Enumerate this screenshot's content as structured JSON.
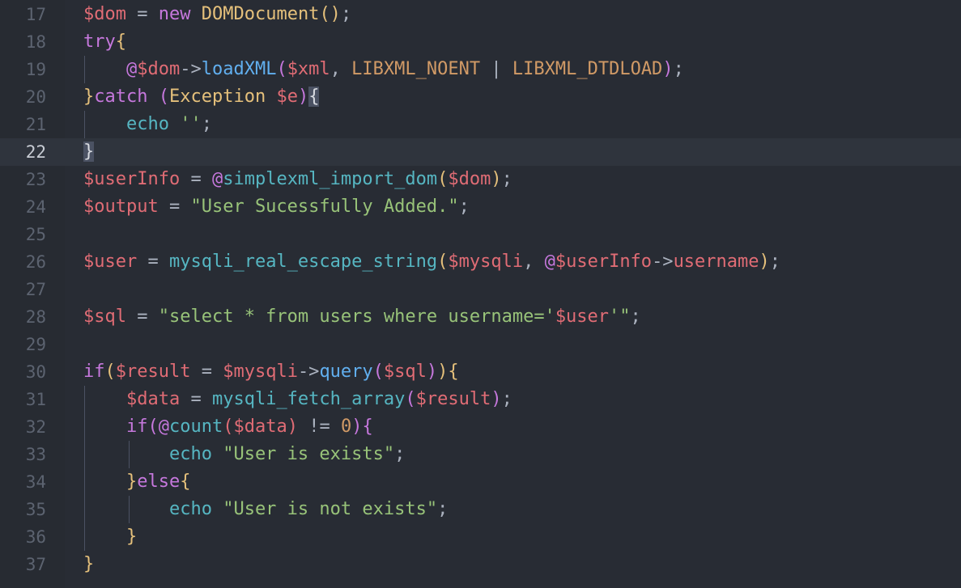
{
  "editor": {
    "theme_colors": {
      "background": "#282c34",
      "variable": "#e06c75",
      "keyword": "#c678dd",
      "class": "#e5c07b",
      "function": "#61afef",
      "builtin": "#56b6c2",
      "string": "#98c379",
      "constant": "#d19a66"
    },
    "current_line": 22,
    "lines": [
      {
        "number": "17",
        "tokens": [
          {
            "text": "$dom",
            "type": "v"
          },
          {
            "text": " = ",
            "type": "p"
          },
          {
            "text": "new",
            "type": "k"
          },
          {
            "text": " ",
            "type": "p"
          },
          {
            "text": "DOMDocument",
            "type": "c"
          },
          {
            "text": "()",
            "type": "pg"
          },
          {
            "text": ";",
            "type": "p"
          }
        ]
      },
      {
        "number": "18",
        "tokens": [
          {
            "text": "try",
            "type": "k"
          },
          {
            "text": "{",
            "type": "pg"
          }
        ]
      },
      {
        "number": "19",
        "tokens": [
          {
            "text": "    ",
            "type": "p"
          },
          {
            "text": "@",
            "type": "k"
          },
          {
            "text": "$dom",
            "type": "v"
          },
          {
            "text": "->",
            "type": "p"
          },
          {
            "text": "loadXML",
            "type": "f"
          },
          {
            "text": "(",
            "type": "pp"
          },
          {
            "text": "$xml",
            "type": "v"
          },
          {
            "text": ", ",
            "type": "p"
          },
          {
            "text": "LIBXML_NOENT",
            "type": "n"
          },
          {
            "text": " | ",
            "type": "p"
          },
          {
            "text": "LIBXML_DTDLOAD",
            "type": "n"
          },
          {
            "text": ")",
            "type": "pp"
          },
          {
            "text": ";",
            "type": "p"
          }
        ]
      },
      {
        "number": "20",
        "tokens": [
          {
            "text": "}",
            "type": "pg"
          },
          {
            "text": "catch",
            "type": "k"
          },
          {
            "text": " ",
            "type": "p"
          },
          {
            "text": "(",
            "type": "pp"
          },
          {
            "text": "Exception",
            "type": "c"
          },
          {
            "text": " ",
            "type": "p"
          },
          {
            "text": "$e",
            "type": "v"
          },
          {
            "text": ")",
            "type": "pp"
          },
          {
            "text": "{",
            "type": "hl"
          }
        ]
      },
      {
        "number": "21",
        "tokens": [
          {
            "text": "    ",
            "type": "p"
          },
          {
            "text": "echo",
            "type": "fi"
          },
          {
            "text": " ",
            "type": "p"
          },
          {
            "text": "''",
            "type": "s"
          },
          {
            "text": ";",
            "type": "p"
          }
        ]
      },
      {
        "number": "22",
        "tokens": [
          {
            "text": "}",
            "type": "hl"
          }
        ]
      },
      {
        "number": "23",
        "tokens": [
          {
            "text": "$userInfo",
            "type": "v"
          },
          {
            "text": " = ",
            "type": "p"
          },
          {
            "text": "@",
            "type": "k"
          },
          {
            "text": "simplexml_import_dom",
            "type": "fi"
          },
          {
            "text": "(",
            "type": "pg"
          },
          {
            "text": "$dom",
            "type": "v"
          },
          {
            "text": ")",
            "type": "pg"
          },
          {
            "text": ";",
            "type": "p"
          }
        ]
      },
      {
        "number": "24",
        "tokens": [
          {
            "text": "$output",
            "type": "v"
          },
          {
            "text": " = ",
            "type": "p"
          },
          {
            "text": "\"User Sucessfully Added.\"",
            "type": "s"
          },
          {
            "text": ";",
            "type": "p"
          }
        ]
      },
      {
        "number": "25",
        "tokens": []
      },
      {
        "number": "26",
        "tokens": [
          {
            "text": "$user",
            "type": "v"
          },
          {
            "text": " = ",
            "type": "p"
          },
          {
            "text": "mysqli_real_escape_string",
            "type": "fi"
          },
          {
            "text": "(",
            "type": "pg"
          },
          {
            "text": "$mysqli",
            "type": "v"
          },
          {
            "text": ", ",
            "type": "p"
          },
          {
            "text": "@",
            "type": "k"
          },
          {
            "text": "$userInfo",
            "type": "v"
          },
          {
            "text": "->",
            "type": "p"
          },
          {
            "text": "username",
            "type": "v"
          },
          {
            "text": ")",
            "type": "pg"
          },
          {
            "text": ";",
            "type": "p"
          }
        ]
      },
      {
        "number": "27",
        "tokens": []
      },
      {
        "number": "28",
        "tokens": [
          {
            "text": "$sql",
            "type": "v"
          },
          {
            "text": " = ",
            "type": "p"
          },
          {
            "text": "\"select * from users where username='",
            "type": "s"
          },
          {
            "text": "$user",
            "type": "v"
          },
          {
            "text": "'\"",
            "type": "s"
          },
          {
            "text": ";",
            "type": "p"
          }
        ]
      },
      {
        "number": "29",
        "tokens": []
      },
      {
        "number": "30",
        "tokens": [
          {
            "text": "if",
            "type": "k"
          },
          {
            "text": "(",
            "type": "pg"
          },
          {
            "text": "$result",
            "type": "v"
          },
          {
            "text": " = ",
            "type": "p"
          },
          {
            "text": "$mysqli",
            "type": "v"
          },
          {
            "text": "->",
            "type": "p"
          },
          {
            "text": "query",
            "type": "f"
          },
          {
            "text": "(",
            "type": "pp"
          },
          {
            "text": "$sql",
            "type": "v"
          },
          {
            "text": ")",
            "type": "pp"
          },
          {
            "text": ")",
            "type": "pg"
          },
          {
            "text": "{",
            "type": "pg"
          }
        ]
      },
      {
        "number": "31",
        "tokens": [
          {
            "text": "    ",
            "type": "p"
          },
          {
            "text": "$data",
            "type": "v"
          },
          {
            "text": " = ",
            "type": "p"
          },
          {
            "text": "mysqli_fetch_array",
            "type": "fi"
          },
          {
            "text": "(",
            "type": "pp"
          },
          {
            "text": "$result",
            "type": "v"
          },
          {
            "text": ")",
            "type": "pp"
          },
          {
            "text": ";",
            "type": "p"
          }
        ]
      },
      {
        "number": "32",
        "tokens": [
          {
            "text": "    ",
            "type": "p"
          },
          {
            "text": "if",
            "type": "k"
          },
          {
            "text": "(",
            "type": "pp"
          },
          {
            "text": "@",
            "type": "k"
          },
          {
            "text": "count",
            "type": "fi"
          },
          {
            "text": "(",
            "type": "pr"
          },
          {
            "text": "$data",
            "type": "v"
          },
          {
            "text": ")",
            "type": "pr"
          },
          {
            "text": " != ",
            "type": "p"
          },
          {
            "text": "0",
            "type": "n"
          },
          {
            "text": ")",
            "type": "pp"
          },
          {
            "text": "{",
            "type": "pp"
          }
        ]
      },
      {
        "number": "33",
        "tokens": [
          {
            "text": "        ",
            "type": "p"
          },
          {
            "text": "echo",
            "type": "fi"
          },
          {
            "text": " ",
            "type": "p"
          },
          {
            "text": "\"User is exists\"",
            "type": "s"
          },
          {
            "text": ";",
            "type": "p"
          }
        ]
      },
      {
        "number": "34",
        "tokens": [
          {
            "text": "    ",
            "type": "p"
          },
          {
            "text": "}",
            "type": "pg"
          },
          {
            "text": "else",
            "type": "k"
          },
          {
            "text": "{",
            "type": "pg"
          }
        ]
      },
      {
        "number": "35",
        "tokens": [
          {
            "text": "        ",
            "type": "p"
          },
          {
            "text": "echo",
            "type": "fi"
          },
          {
            "text": " ",
            "type": "p"
          },
          {
            "text": "\"User is not exists\"",
            "type": "s"
          },
          {
            "text": ";",
            "type": "p"
          }
        ]
      },
      {
        "number": "36",
        "tokens": [
          {
            "text": "    ",
            "type": "p"
          },
          {
            "text": "}",
            "type": "pg"
          }
        ]
      },
      {
        "number": "37",
        "tokens": [
          {
            "text": "}",
            "type": "pg"
          }
        ]
      }
    ]
  }
}
